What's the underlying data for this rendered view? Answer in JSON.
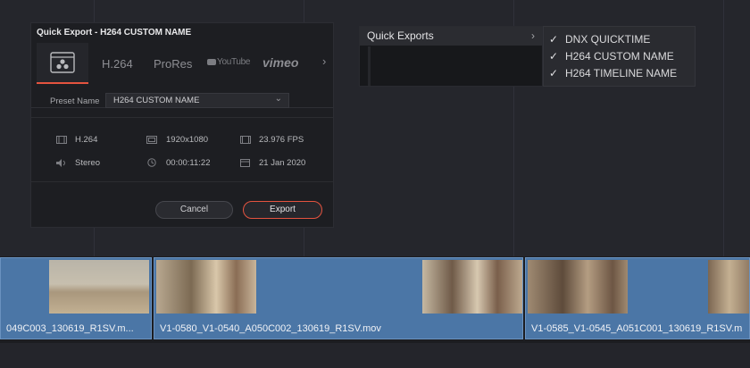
{
  "dialog": {
    "title": "Quick Export - H264 CUSTOM NAME",
    "tabs": [
      "H.264",
      "ProRes",
      "YouTube",
      "vimeo"
    ],
    "tab_next": "›",
    "preset_label": "Preset Name",
    "preset_value": "H264 CUSTOM NAME",
    "preset_chevron": "⌄",
    "specs": {
      "codec": "H.264",
      "resolution": "1920x1080",
      "fps": "23.976 FPS",
      "audio": "Stereo",
      "duration": "00:00:11:22",
      "date": "21 Jan 2020"
    },
    "cancel_label": "Cancel",
    "export_label": "Export"
  },
  "menu": {
    "title": "Quick Exports",
    "arrow": "›",
    "items": [
      {
        "label": "DNX QUICKTIME",
        "check": "✓"
      },
      {
        "label": "H264 CUSTOM NAME",
        "check": "✓"
      },
      {
        "label": "H264 TIMELINE NAME",
        "check": "✓"
      }
    ]
  },
  "timeline": {
    "clips": [
      "049C003_130619_R1SV.m...",
      "V1-0580_V1-0540_A050C002_130619_R1SV.mov",
      "V1-0585_V1-0545_A051C001_130619_R1SV.m"
    ]
  },
  "colors": {
    "accent": "#e4533f",
    "clip_blue": "#4b76a6",
    "background": "#25262c"
  }
}
